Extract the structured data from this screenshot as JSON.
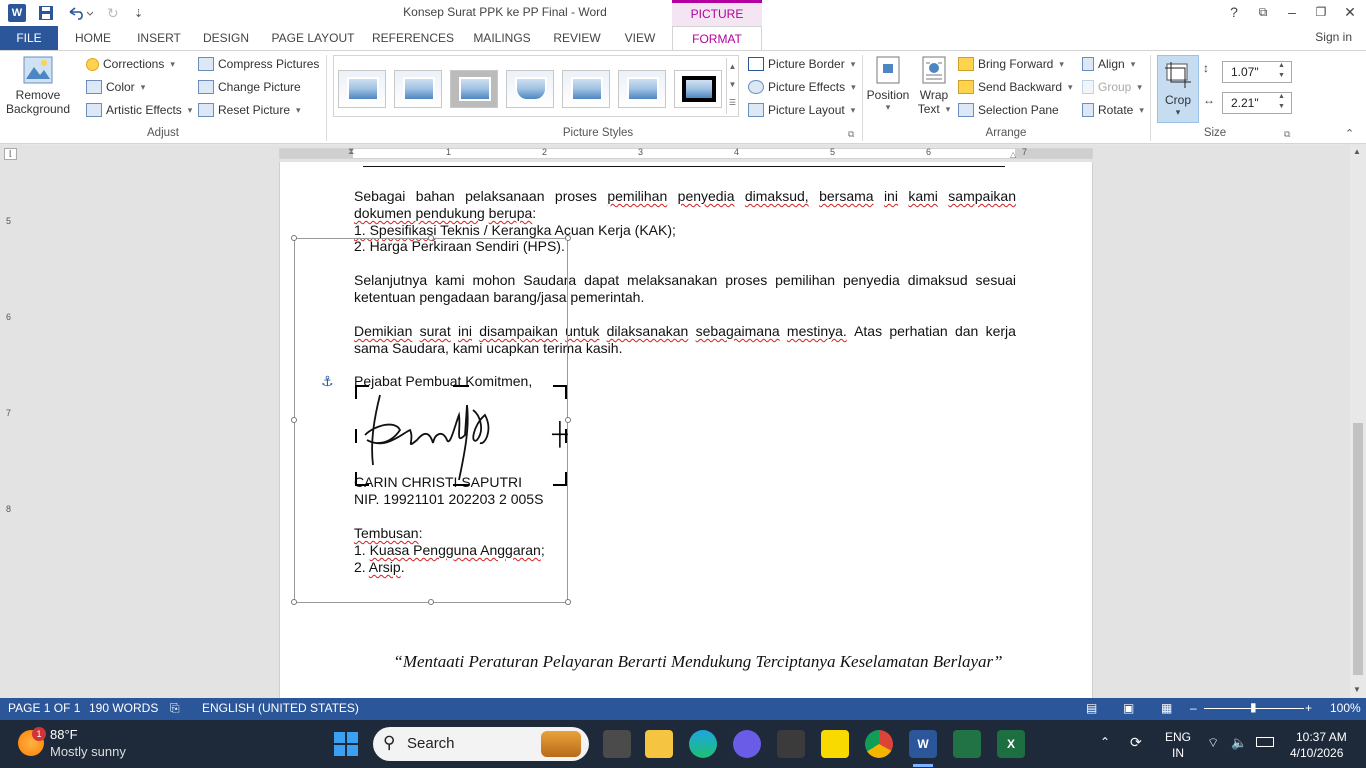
{
  "window": {
    "title": "Konsep Surat PPK ke PP Final - Word",
    "picture_tools": "PICTURE TOOLS",
    "help": "?",
    "signin": "Sign in"
  },
  "tabs": [
    "FILE",
    "HOME",
    "INSERT",
    "DESIGN",
    "PAGE LAYOUT",
    "REFERENCES",
    "MAILINGS",
    "REVIEW",
    "VIEW",
    "FORMAT"
  ],
  "ribbon": {
    "adjust": {
      "label": "Adjust",
      "remove_bg_1": "Remove",
      "remove_bg_2": "Background",
      "corrections": "Corrections",
      "color": "Color",
      "artistic": "Artistic Effects",
      "compress": "Compress Pictures",
      "change": "Change Picture",
      "reset": "Reset Picture"
    },
    "picture_styles": {
      "label": "Picture Styles",
      "border": "Picture Border",
      "effects": "Picture Effects",
      "layout": "Picture Layout"
    },
    "arrange": {
      "label": "Arrange",
      "position": "Position",
      "wrap_1": "Wrap",
      "wrap_2": "Text",
      "bring_forward": "Bring Forward",
      "send_backward": "Send Backward",
      "selection_pane": "Selection Pane",
      "align": "Align",
      "group": "Group",
      "rotate": "Rotate"
    },
    "size": {
      "label": "Size",
      "crop": "Crop",
      "height": "1.07\"",
      "width": "2.21\""
    }
  },
  "ruler": {
    "h_numbers": [
      "1",
      "2",
      "3",
      "4",
      "5",
      "6",
      "7"
    ],
    "v_numbers": [
      "5",
      "6",
      "7",
      "8"
    ]
  },
  "document": {
    "p1_words": [
      "Sebagai",
      "bahan",
      "pelaksanaan",
      "proses",
      "pemilihan",
      "penyedia",
      "dimaksud,",
      "bersama",
      "ini",
      "kami",
      "sampaikan"
    ],
    "p1_line2a": "dokumen pendukung",
    "p1_line2b": "berupa",
    "p1_line2c": ":",
    "item1a": "1.  Spesifikasi",
    "item1b": "Teknis / Kerangka Acuan Kerja (KAK);",
    "item2": "2.  Harga Perkiraan Sendiri (HPS).",
    "p2_line1": "Selanjutnya kami mohon Saudara dapat melaksanakan proses pemilihan penyedia dimaksud sesuai",
    "p2_line2": "ketentuan pengadaan barang/jasa pemerintah.",
    "p3_line1_words": [
      "Demikian",
      "surat",
      "ini",
      "disampaikan",
      "untuk",
      "dilaksanakan",
      "sebagaimana",
      "mestinya.",
      "Atas",
      "perhatian",
      "dan",
      "kerja"
    ],
    "p3_line2": "sama Saudara, kami ucapkan terima kasih.",
    "signer_title": "Pejabat Pembuat Komitmen,",
    "signer_name": "CARIN CHRISTI SAPUTRI",
    "nip": "NIP.  19921101 202203 2 005S",
    "tembusan": "Tembusan",
    "tembusan_colon": ":",
    "cc1_num": "1. ",
    "cc1": "Kuasa Pengguna Anggaran",
    "cc1_end": ";",
    "cc2_num": "2. ",
    "cc2": "Arsip",
    "cc2_end": ".",
    "motto": "“Mentaati Peraturan Pelayaran Berarti Mendukung Terciptanya Keselamatan Berlayar”"
  },
  "status": {
    "page": "PAGE 1 OF 1",
    "words": "190 WORDS",
    "language": "ENGLISH (UNITED STATES)",
    "zoom": "100%"
  },
  "taskbar": {
    "weather_temp": "88°F",
    "weather_desc": "Mostly sunny",
    "weather_badge": "1",
    "search": "Search",
    "lang1": "ENG",
    "lang2": "IN",
    "time": "10:37 AM",
    "date": "4/10/2026"
  }
}
